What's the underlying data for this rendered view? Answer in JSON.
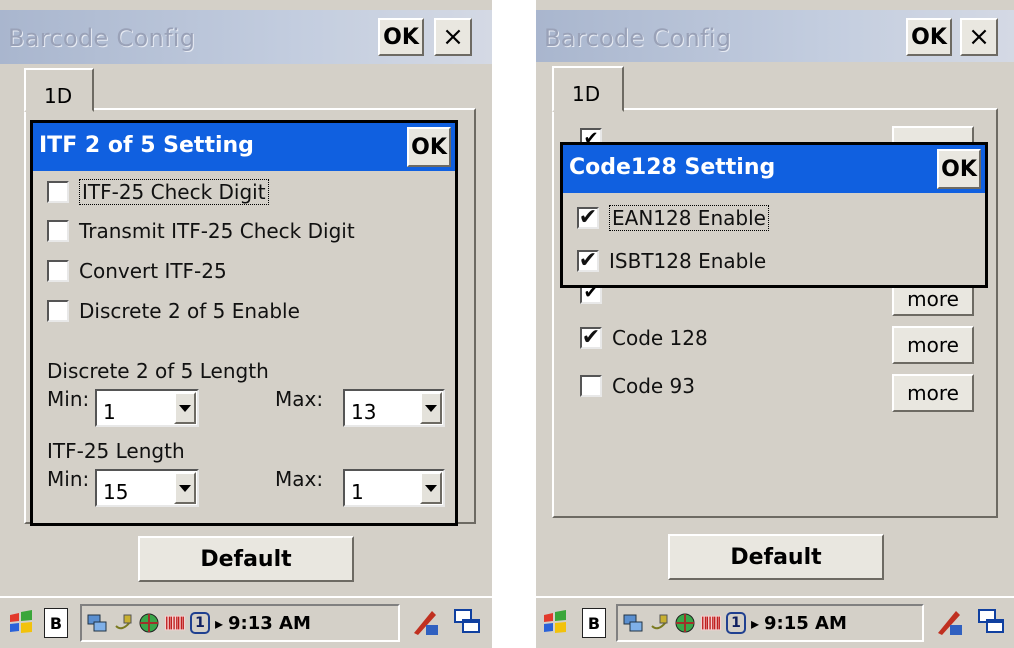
{
  "left": {
    "window_title": "Barcode Config",
    "ok_label": "OK",
    "close_label": "×",
    "tab_label": "1D",
    "dialog": {
      "title": "ITF 2 of 5 Setting",
      "ok_label": "OK",
      "checkboxes": [
        {
          "label": "ITF-25 Check Digit",
          "checked": false
        },
        {
          "label": "Transmit ITF-25 Check Digit",
          "checked": false
        },
        {
          "label": "Convert ITF-25",
          "checked": false
        },
        {
          "label": "Discrete 2 of 5 Enable",
          "checked": false
        }
      ],
      "discrete_length_label": "Discrete 2 of 5 Length",
      "itf_length_label": "ITF-25 Length",
      "min_label": "Min:",
      "max_label": "Max:",
      "discrete_min": "1",
      "discrete_max": "13",
      "itf_min": "15",
      "itf_max": "1"
    },
    "default_button": "Default",
    "taskbar": {
      "key_label": "B",
      "time": "9:13 AM",
      "tray_one": "1"
    }
  },
  "right": {
    "window_title": "Barcode Config",
    "ok_label": "OK",
    "close_label": "×",
    "tab_label": "1D",
    "list_items": [
      {
        "label": "Code 128",
        "checked": true,
        "more": "more"
      },
      {
        "label": "Code 93",
        "checked": false,
        "more": "more"
      }
    ],
    "partial_more_label": "more",
    "dialog": {
      "title": "Code128 Setting",
      "ok_label": "OK",
      "checkboxes": [
        {
          "label": "EAN128 Enable",
          "checked": true
        },
        {
          "label": "ISBT128 Enable",
          "checked": true
        }
      ]
    },
    "default_button": "Default",
    "taskbar": {
      "key_label": "B",
      "time": "9:15 AM",
      "tray_one": "1"
    }
  },
  "check_glyph": "✔",
  "icons": [
    "windows-start-icon",
    "keyboard-b-icon",
    "network-icon",
    "power-plug-icon",
    "globe-icon",
    "barcode-icon",
    "tray-one-icon",
    "arrow-icon",
    "input-panel-icon",
    "window-switch-icon"
  ]
}
